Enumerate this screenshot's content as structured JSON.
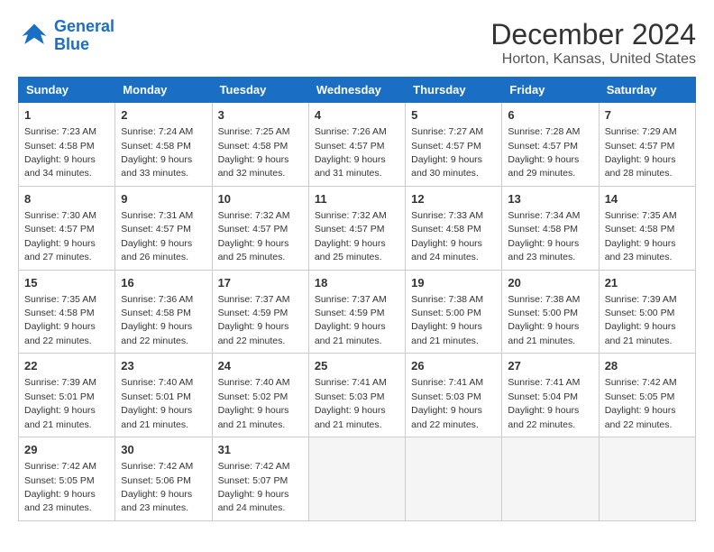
{
  "logo": {
    "line1": "General",
    "line2": "Blue"
  },
  "title": "December 2024",
  "subtitle": "Horton, Kansas, United States",
  "days_of_week": [
    "Sunday",
    "Monday",
    "Tuesday",
    "Wednesday",
    "Thursday",
    "Friday",
    "Saturday"
  ],
  "weeks": [
    [
      {
        "day": "1",
        "sunrise": "7:23 AM",
        "sunset": "4:58 PM",
        "daylight": "9 hours and 34 minutes."
      },
      {
        "day": "2",
        "sunrise": "7:24 AM",
        "sunset": "4:58 PM",
        "daylight": "9 hours and 33 minutes."
      },
      {
        "day": "3",
        "sunrise": "7:25 AM",
        "sunset": "4:58 PM",
        "daylight": "9 hours and 32 minutes."
      },
      {
        "day": "4",
        "sunrise": "7:26 AM",
        "sunset": "4:57 PM",
        "daylight": "9 hours and 31 minutes."
      },
      {
        "day": "5",
        "sunrise": "7:27 AM",
        "sunset": "4:57 PM",
        "daylight": "9 hours and 30 minutes."
      },
      {
        "day": "6",
        "sunrise": "7:28 AM",
        "sunset": "4:57 PM",
        "daylight": "9 hours and 29 minutes."
      },
      {
        "day": "7",
        "sunrise": "7:29 AM",
        "sunset": "4:57 PM",
        "daylight": "9 hours and 28 minutes."
      }
    ],
    [
      {
        "day": "8",
        "sunrise": "7:30 AM",
        "sunset": "4:57 PM",
        "daylight": "9 hours and 27 minutes."
      },
      {
        "day": "9",
        "sunrise": "7:31 AM",
        "sunset": "4:57 PM",
        "daylight": "9 hours and 26 minutes."
      },
      {
        "day": "10",
        "sunrise": "7:32 AM",
        "sunset": "4:57 PM",
        "daylight": "9 hours and 25 minutes."
      },
      {
        "day": "11",
        "sunrise": "7:32 AM",
        "sunset": "4:57 PM",
        "daylight": "9 hours and 25 minutes."
      },
      {
        "day": "12",
        "sunrise": "7:33 AM",
        "sunset": "4:58 PM",
        "daylight": "9 hours and 24 minutes."
      },
      {
        "day": "13",
        "sunrise": "7:34 AM",
        "sunset": "4:58 PM",
        "daylight": "9 hours and 23 minutes."
      },
      {
        "day": "14",
        "sunrise": "7:35 AM",
        "sunset": "4:58 PM",
        "daylight": "9 hours and 23 minutes."
      }
    ],
    [
      {
        "day": "15",
        "sunrise": "7:35 AM",
        "sunset": "4:58 PM",
        "daylight": "9 hours and 22 minutes."
      },
      {
        "day": "16",
        "sunrise": "7:36 AM",
        "sunset": "4:58 PM",
        "daylight": "9 hours and 22 minutes."
      },
      {
        "day": "17",
        "sunrise": "7:37 AM",
        "sunset": "4:59 PM",
        "daylight": "9 hours and 22 minutes."
      },
      {
        "day": "18",
        "sunrise": "7:37 AM",
        "sunset": "4:59 PM",
        "daylight": "9 hours and 21 minutes."
      },
      {
        "day": "19",
        "sunrise": "7:38 AM",
        "sunset": "5:00 PM",
        "daylight": "9 hours and 21 minutes."
      },
      {
        "day": "20",
        "sunrise": "7:38 AM",
        "sunset": "5:00 PM",
        "daylight": "9 hours and 21 minutes."
      },
      {
        "day": "21",
        "sunrise": "7:39 AM",
        "sunset": "5:00 PM",
        "daylight": "9 hours and 21 minutes."
      }
    ],
    [
      {
        "day": "22",
        "sunrise": "7:39 AM",
        "sunset": "5:01 PM",
        "daylight": "9 hours and 21 minutes."
      },
      {
        "day": "23",
        "sunrise": "7:40 AM",
        "sunset": "5:01 PM",
        "daylight": "9 hours and 21 minutes."
      },
      {
        "day": "24",
        "sunrise": "7:40 AM",
        "sunset": "5:02 PM",
        "daylight": "9 hours and 21 minutes."
      },
      {
        "day": "25",
        "sunrise": "7:41 AM",
        "sunset": "5:03 PM",
        "daylight": "9 hours and 21 minutes."
      },
      {
        "day": "26",
        "sunrise": "7:41 AM",
        "sunset": "5:03 PM",
        "daylight": "9 hours and 22 minutes."
      },
      {
        "day": "27",
        "sunrise": "7:41 AM",
        "sunset": "5:04 PM",
        "daylight": "9 hours and 22 minutes."
      },
      {
        "day": "28",
        "sunrise": "7:42 AM",
        "sunset": "5:05 PM",
        "daylight": "9 hours and 22 minutes."
      }
    ],
    [
      {
        "day": "29",
        "sunrise": "7:42 AM",
        "sunset": "5:05 PM",
        "daylight": "9 hours and 23 minutes."
      },
      {
        "day": "30",
        "sunrise": "7:42 AM",
        "sunset": "5:06 PM",
        "daylight": "9 hours and 23 minutes."
      },
      {
        "day": "31",
        "sunrise": "7:42 AM",
        "sunset": "5:07 PM",
        "daylight": "9 hours and 24 minutes."
      },
      null,
      null,
      null,
      null
    ]
  ]
}
